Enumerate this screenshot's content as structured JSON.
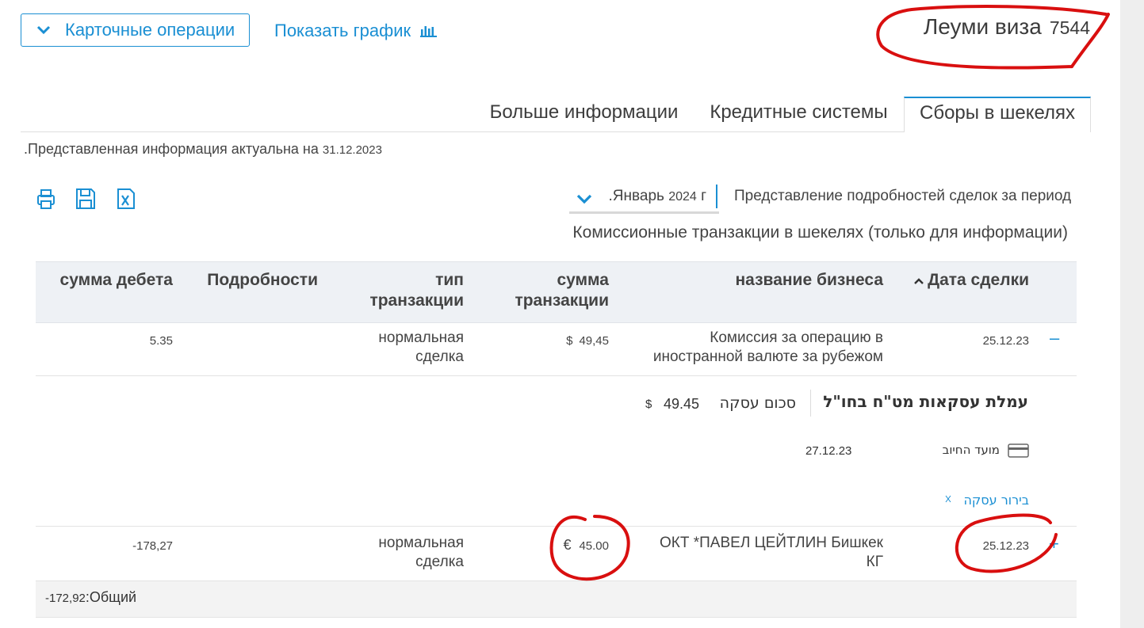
{
  "header": {
    "card_operations_label": "Карточные операции",
    "show_chart_label": "Показать график",
    "card_name": "Леуми виза",
    "card_number": "7544"
  },
  "tabs": [
    {
      "label": "Больше информации",
      "active": false
    },
    {
      "label": "Кредитные системы",
      "active": false
    },
    {
      "label": "Сборы в шекелях",
      "active": true
    }
  ],
  "info": {
    "text": ".Представленная информация актуальна на",
    "date": "31.12.2023"
  },
  "toolbar": {
    "print_icon": "printer-icon",
    "save_icon": "save-icon",
    "excel_icon": "excel-icon"
  },
  "period": {
    "label": "Представление подробностей сделок за период",
    "month": ".Январь",
    "year": "2024",
    "suffix": "г"
  },
  "section_title": "Комиссионные транзакции в шекелях (только для информации)",
  "table": {
    "headers": {
      "date": "Дата сделки",
      "business": "название бизнеса",
      "amount_line1": "сумма",
      "amount_line2": "транзакции",
      "type_line1": "тип",
      "type_line2": "транзакции",
      "details": "Подробности",
      "debit": "сумма дебета"
    },
    "rows": [
      {
        "date": "25.12.23",
        "business_line1": "Комиссия за операцию в",
        "business_line2": "иностранной валюте за рубежом",
        "currency": "$",
        "amount": "49,45",
        "type_line1": "нормальная",
        "type_line2": "сделка",
        "debit": "5.35",
        "toggle": "–"
      },
      {
        "date": "25.12.23",
        "business_line1": "ОКТ *ПАВЕЛ ЦЕЙТЛИН Бишкек",
        "business_line2": "КГ",
        "currency": "€",
        "amount": "45.00",
        "type_line1": "нормальная",
        "type_line2": "сделка",
        "debit": "-178,27",
        "toggle": "+"
      }
    ]
  },
  "detail": {
    "title": "עמלת עסקאות מט\"ח בחו\"ל",
    "amount_label": "סכום עסקה",
    "amount_value": "49.45",
    "amount_currency": "$",
    "charge_date_label": "מועד החיוב",
    "charge_date_value": "27.12.23",
    "inquiry_link": "בירור עסקה",
    "inquiry_icon": "external-link-icon"
  },
  "total": {
    "label": ":Общий",
    "value": "-172,92"
  },
  "colors": {
    "accent": "#1a8fd3",
    "annotation": "#d90f0f",
    "header_bg": "#eef1f5"
  }
}
